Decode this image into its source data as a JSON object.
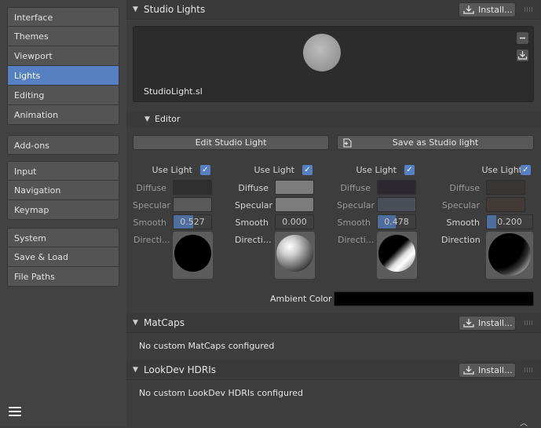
{
  "sidebar": {
    "groups": [
      [
        "Interface",
        "Themes",
        "Viewport",
        "Lights",
        "Editing",
        "Animation"
      ],
      [
        "Add-ons"
      ],
      [
        "Input",
        "Navigation",
        "Keymap"
      ],
      [
        "System",
        "Save & Load",
        "File Paths"
      ]
    ],
    "active": "Lights"
  },
  "studio_lights": {
    "title": "Studio Lights",
    "install_label": "Install...",
    "preview_label": "StudioLight.sl"
  },
  "editor": {
    "title": "Editor",
    "edit_btn": "Edit Studio Light",
    "save_btn": "Save as Studio light",
    "labels": {
      "use_light": "Use Light",
      "diffuse": "Diffuse",
      "specular": "Specular",
      "smooth": "Smooth"
    },
    "lights": [
      {
        "direction_label": "Directi...",
        "smooth": "0.527",
        "smooth_frac": 0.527,
        "use_light": true,
        "diffuse_color": "#2f2f2f",
        "specular_color": "#595959"
      },
      {
        "direction_label": "Directi...",
        "smooth": "0.000",
        "smooth_frac": 0.0,
        "use_light": true,
        "diffuse_color": "#7c7c7c",
        "specular_color": "#7c7c7c"
      },
      {
        "direction_label": "Directi...",
        "smooth": "0.478",
        "smooth_frac": 0.478,
        "use_light": true,
        "diffuse_color": "#2c2930",
        "specular_color": "#4a4e58"
      },
      {
        "direction_label": "Direction",
        "smooth": "0.200",
        "smooth_frac": 0.2,
        "use_light": true,
        "diffuse_color": "#383634",
        "specular_color": "#413a36"
      }
    ],
    "ambient_label": "Ambient Color",
    "ambient_color": "#000000"
  },
  "matcaps": {
    "title": "MatCaps",
    "install_label": "Install...",
    "empty_text": "No custom MatCaps configured"
  },
  "lookdev": {
    "title": "LookDev HDRIs",
    "install_label": "Install...",
    "empty_text": "No custom LookDev HDRIs configured"
  }
}
